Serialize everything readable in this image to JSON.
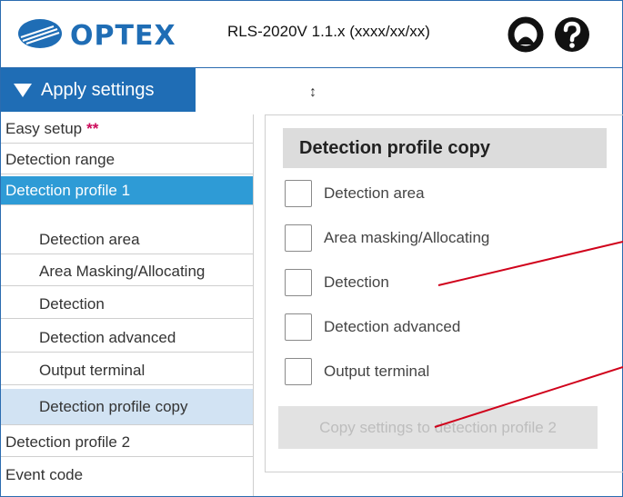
{
  "header": {
    "brand": "OPTEX",
    "version": "RLS-2020V 1.1.x (xxxx/xx/xx)",
    "icons": [
      "user-icon",
      "help-icon"
    ]
  },
  "toolbar": {
    "apply_label": "Apply settings",
    "resize_glyph": "↕"
  },
  "sidebar": {
    "items": [
      {
        "label": "Easy setup",
        "marker": "**"
      },
      {
        "label": "Detection range"
      },
      {
        "label": "Detection profile 1"
      },
      {
        "label": "Detection area"
      },
      {
        "label": "Area Masking/Allocating"
      },
      {
        "label": "Detection"
      },
      {
        "label": "Detection advanced"
      },
      {
        "label": "Output terminal"
      },
      {
        "label": "Detection profile copy"
      },
      {
        "label": "Detection profile 2"
      },
      {
        "label": "Event code"
      }
    ],
    "active_item": "Detection profile 1",
    "selected_item": "Detection profile copy"
  },
  "main": {
    "title": "Detection profile copy",
    "options": [
      {
        "label": "Detection area",
        "checked": false
      },
      {
        "label": "Area masking/Allocating",
        "checked": false
      },
      {
        "label": "Detection",
        "checked": false
      },
      {
        "label": "Detection advanced",
        "checked": false
      },
      {
        "label": "Output terminal",
        "checked": false
      }
    ],
    "copy_button_label": "Copy settings to detection profile 2",
    "copy_button_disabled": true
  },
  "colors": {
    "brand_blue": "#1f6db5",
    "active_item": "#2e9bd6",
    "selected_item": "#d2e3f3",
    "annotation_line": "#d0021b",
    "marker": "#cc0a5a"
  }
}
